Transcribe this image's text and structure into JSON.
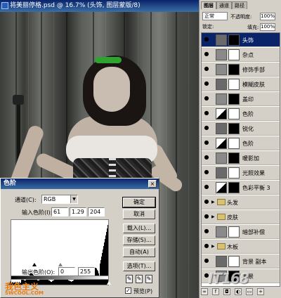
{
  "document": {
    "title": "将美丽停格.psd @ 16.7% (头饰, 图层蒙版/8)"
  },
  "levels_dialog": {
    "title": "色阶",
    "close_symbol": "×",
    "channel_label": "通道(C):",
    "channel_value": "RGB",
    "input_label": "输入色阶(I):",
    "input_black": "61",
    "input_gamma": "1.29",
    "input_white": "204",
    "output_label": "输出色阶(O):",
    "output_black": "0",
    "output_white": "255",
    "buttons": {
      "ok": "确定",
      "cancel": "取消",
      "load": "载入(L)...",
      "save": "存储(S)...",
      "auto": "自动(A)",
      "options": "选项(T)..."
    },
    "preview_label": "预览(P)",
    "preview_checked": true
  },
  "watermark": {
    "logo": "我色主义",
    "url": "SWCOOL.COM",
    "right_logo": "IT168"
  },
  "layers_panel": {
    "tabs": [
      "图层",
      "通道",
      "路径"
    ],
    "blend_mode": "正常",
    "opacity_label": "不透明度:",
    "opacity_value": "100%",
    "lock_label": "锁定:",
    "fill_label": "填充:",
    "fill_value": "100%",
    "layers": [
      {
        "name": "头饰",
        "type": "layer",
        "selected": true
      },
      {
        "name": "杂点",
        "type": "layer",
        "selected": false
      },
      {
        "name": "修饰手部",
        "type": "layer",
        "selected": false
      },
      {
        "name": "模糊皮肤",
        "type": "layer",
        "selected": false
      },
      {
        "name": "盖印",
        "type": "layer",
        "selected": false
      },
      {
        "name": "色阶",
        "type": "adjustment",
        "selected": false
      },
      {
        "name": "锐化",
        "type": "layer",
        "selected": false
      },
      {
        "name": "色阶",
        "type": "adjustment",
        "selected": false
      },
      {
        "name": "暖影加",
        "type": "layer",
        "selected": false
      },
      {
        "name": "光照效果",
        "type": "layer",
        "selected": false
      },
      {
        "name": "色彩平衡 3",
        "type": "adjustment",
        "selected": false
      },
      {
        "name": "头发",
        "type": "folder",
        "selected": false
      },
      {
        "name": "皮肤",
        "type": "folder",
        "selected": false
      },
      {
        "name": "暗部补偿",
        "type": "layer",
        "selected": false
      },
      {
        "name": "木板",
        "type": "folder",
        "selected": false
      },
      {
        "name": "背景 副本",
        "type": "layer",
        "selected": false
      },
      {
        "name": "背景",
        "type": "layer",
        "selected": false
      }
    ]
  }
}
